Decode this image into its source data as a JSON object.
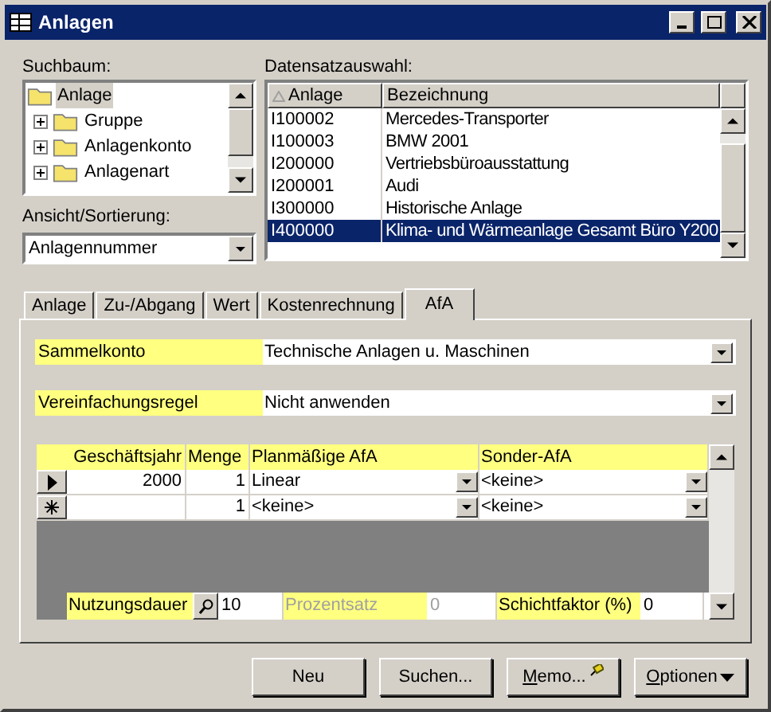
{
  "window": {
    "title": "Anlagen"
  },
  "tree": {
    "label": "Suchbaum:",
    "items": [
      {
        "label": "Anlage",
        "selected": true,
        "children": [
          {
            "label": "Gruppe",
            "selected": false,
            "expanded": false
          },
          {
            "label": "Anlagenkonto",
            "selected": false,
            "expanded": false
          },
          {
            "label": "Anlagenart",
            "selected": false,
            "expanded": false
          }
        ]
      }
    ]
  },
  "view": {
    "label": "Ansicht/Sortierung:",
    "value": "Anlagennummer"
  },
  "records": {
    "label": "Datensatzauswahl:",
    "columns": [
      "Anlage",
      "Bezeichnung"
    ],
    "rows": [
      {
        "cells": [
          "I100002",
          "Mercedes-Transporter"
        ],
        "selected": false
      },
      {
        "cells": [
          "I100003",
          "BMW 2001"
        ],
        "selected": false
      },
      {
        "cells": [
          "I200000",
          "Vertriebsbüroausstattung"
        ],
        "selected": false
      },
      {
        "cells": [
          "I200001",
          "Audi"
        ],
        "selected": false
      },
      {
        "cells": [
          "I300000",
          "Historische Anlage"
        ],
        "selected": false
      },
      {
        "cells": [
          "I400000",
          "Klima- und Wärmeanlage Gesamt Büro Y200"
        ],
        "selected": true
      }
    ]
  },
  "tabs": [
    {
      "label": "Anlage",
      "selected": false
    },
    {
      "label": "Zu-/Abgang",
      "selected": false
    },
    {
      "label": "Wert",
      "selected": false
    },
    {
      "label": "Kostenrechnung",
      "selected": false
    },
    {
      "label": "AfA",
      "selected": true
    }
  ],
  "fields": [
    {
      "label": "Sammelkonto",
      "value": "Technische Anlagen u. Maschinen"
    },
    {
      "label": "Vereinfachungsregel",
      "value": "Nicht anwenden"
    }
  ],
  "afa_table": {
    "columns": [
      "Geschäftsjahr",
      "Menge",
      "Planmäßige AfA",
      "Sonder-AfA"
    ],
    "rows": [
      {
        "kind": "current",
        "cells": [
          "2000",
          "1",
          "Linear",
          "<keine>"
        ]
      },
      {
        "kind": "new",
        "cells": [
          "",
          "1",
          "<keine>",
          "<keine>"
        ]
      }
    ],
    "footer": [
      {
        "label": "Nutzungsdauer",
        "value": "10",
        "disabled": false,
        "kind": "lookup"
      },
      {
        "label": "Prozentsatz",
        "value": "0",
        "disabled": true,
        "kind": "plain"
      },
      {
        "label": "Schichtfaktor (%)",
        "value": "0",
        "disabled": false,
        "kind": "plain"
      }
    ]
  },
  "buttons": [
    {
      "label": "Neu",
      "mnemonic": false,
      "kind": "plain"
    },
    {
      "label": "Suchen...",
      "mnemonic": false,
      "kind": "plain"
    },
    {
      "label": "Memo...",
      "mnemonic": true,
      "kind": "pin"
    },
    {
      "label": "Optionen",
      "mnemonic": true,
      "kind": "menu"
    }
  ]
}
